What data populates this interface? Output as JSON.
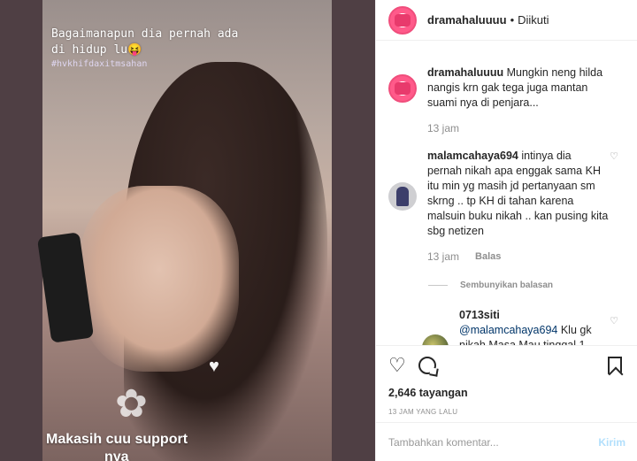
{
  "story": {
    "text_line1": "Bagaimanapun dia pernah ada",
    "text_line2": "di hidup lu",
    "emoji": "😝",
    "tag": "#hvkhifdaxitmsahan",
    "caption_line1": "Makasih cuu support",
    "caption_line2": "nya"
  },
  "header": {
    "username": "dramahaluuuu",
    "separator": "•",
    "follow_status": "Diikuti"
  },
  "comments": [
    {
      "username": "dramahaluuuu",
      "text": "Mungkin neng hilda nangis krn gak tega juga mantan suami nya di penjara...",
      "time": "13 jam"
    },
    {
      "username": "malamcahaya694",
      "text": "intinya dia pernah nikah apa enggak sama KH itu min yg masih jd pertanyaan sm skrng .. tp KH di tahan karena malsuin buku nikah .. kan pusing kita sbg netizen",
      "time": "13 jam",
      "reply_label": "Balas"
    }
  ],
  "hide_replies": "Sembunyikan balasan",
  "reply": {
    "username": "0713siti",
    "mention": "@malamcahaya694",
    "text": "Klu gk nikah Masa Mau tinggal 1"
  },
  "actions": {
    "views": "2,646 tayangan",
    "time": "13 JAM YANG LALU"
  },
  "add_comment": {
    "placeholder": "Tambahkan komentar...",
    "send_label": "Kirim"
  }
}
